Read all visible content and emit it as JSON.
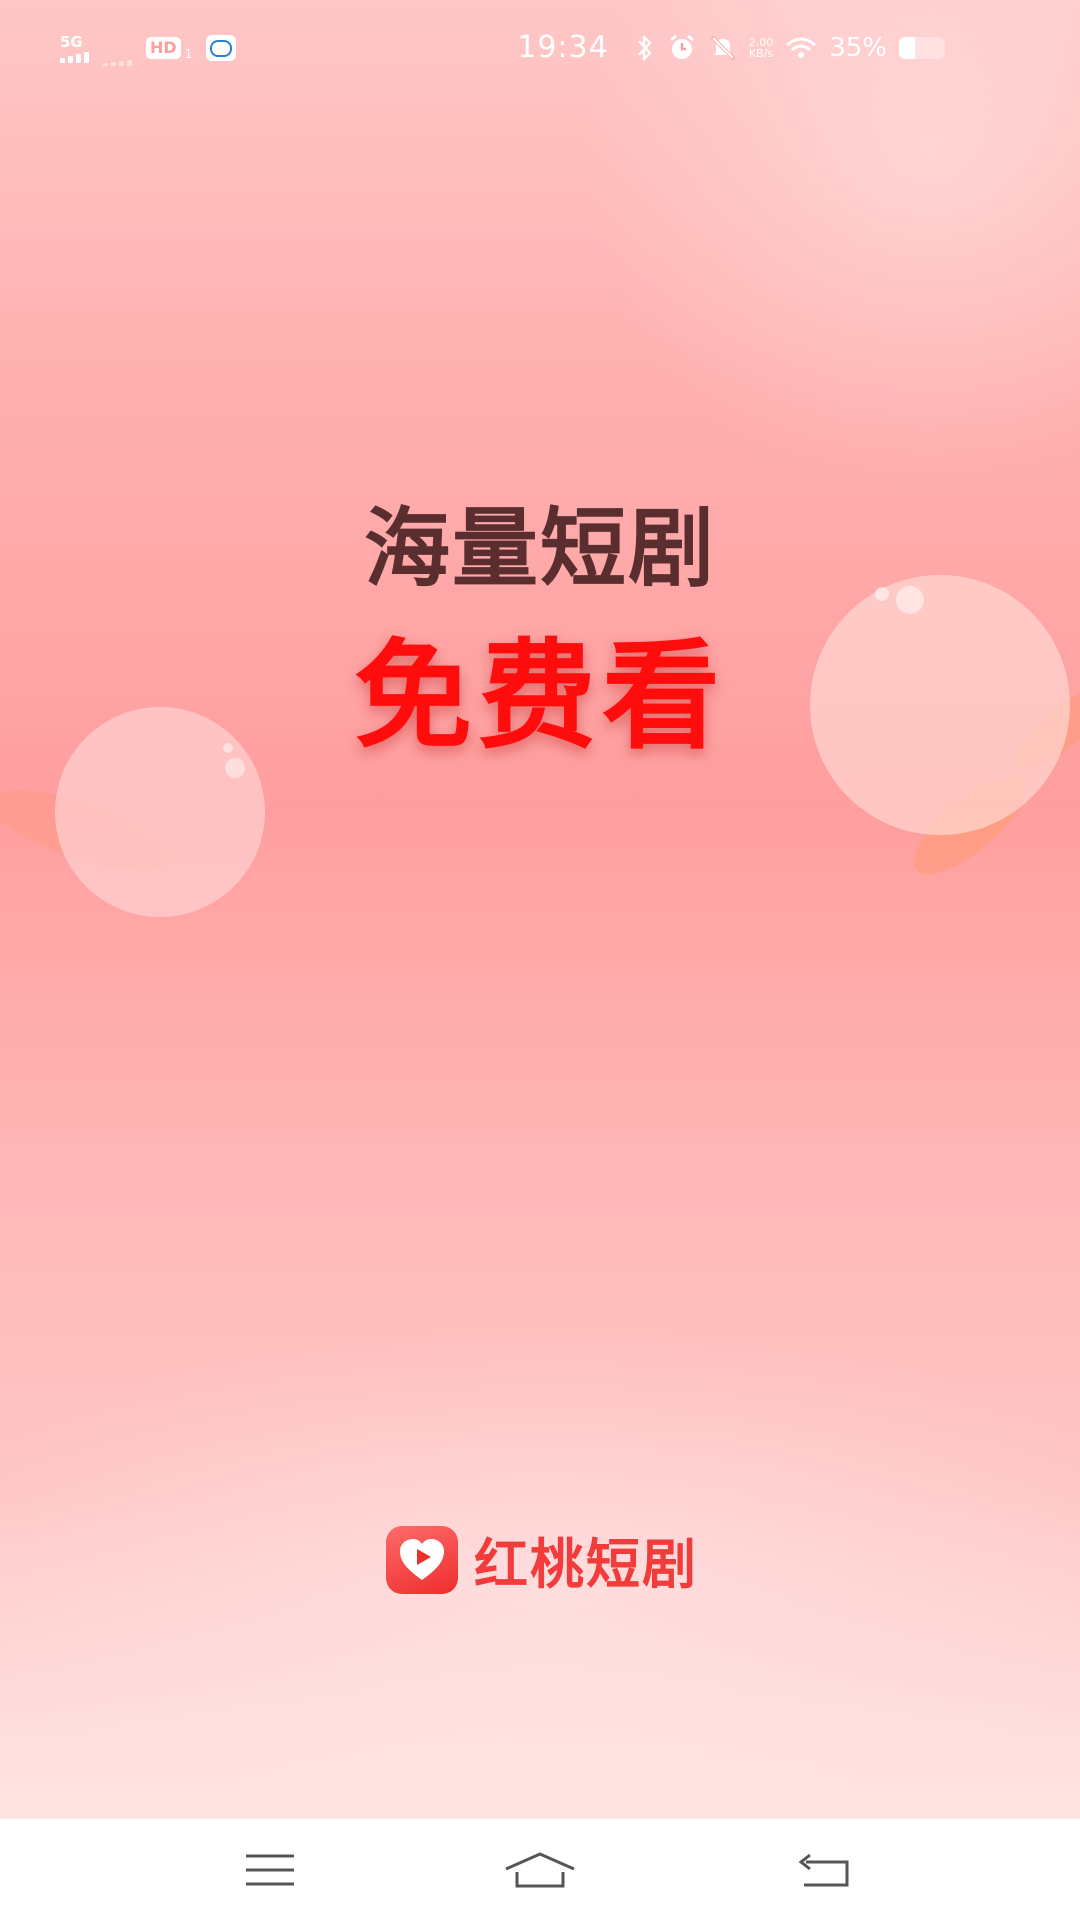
{
  "status_bar": {
    "network": "5G",
    "hd": "HD",
    "hd_sim": "1",
    "time": "19:34",
    "speed_value": "2.00",
    "speed_unit": "KB/s",
    "battery": "35%",
    "battery_level": 0.35,
    "icons": [
      "signal-icon",
      "hd-icon",
      "chat-icon",
      "bluetooth-icon",
      "alarm-icon",
      "mute-icon",
      "wifi-icon",
      "battery-icon"
    ]
  },
  "splash": {
    "headline_line1": "海量短剧",
    "headline_line2": "免费看",
    "logo_text": "红桃短剧",
    "logo_icon": "play-heart-icon"
  },
  "nav_bar": {
    "icons": [
      "menu-icon",
      "home-icon",
      "back-icon"
    ]
  },
  "colors": {
    "headline_primary": "#5a2e2e",
    "headline_accent": "#ff0d0d",
    "brand": "#f23b3b",
    "background": "#ffb0b0"
  }
}
